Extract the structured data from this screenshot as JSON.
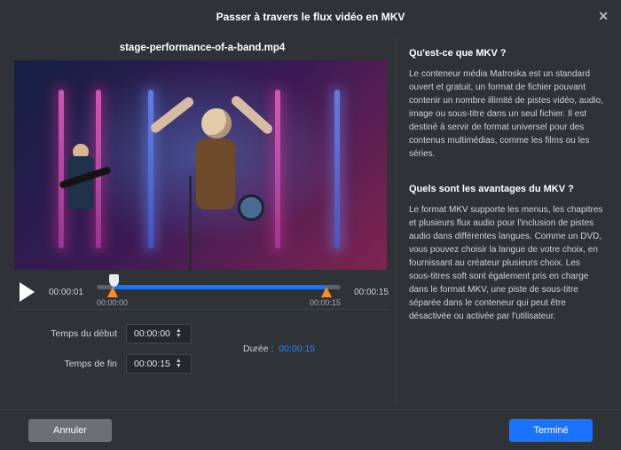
{
  "dialog": {
    "title": "Passer à travers le flux vidéo en MKV"
  },
  "file": {
    "name": "stage-performance-of-a-band.mp4"
  },
  "player": {
    "current_time": "00:00:01",
    "total_time": "00:00:15",
    "ruler_start": "00:00:00",
    "ruler_end": "00:00:15"
  },
  "trim": {
    "start_label": "Temps du début",
    "end_label": "Temps de fin",
    "start_value": "00:00:00",
    "end_value": "00:00:15",
    "duration_label": "Durée :",
    "duration_value": "00:00:15"
  },
  "info": {
    "q1_title": "Qu'est-ce que MKV ?",
    "q1_body": "Le conteneur média Matroska est un standard ouvert et gratuit, un format de fichier pouvant contenir un nombre illimité de pistes vidéo, audio, image ou sous-titre dans un seul fichier. Il est destiné à servir de format universel pour des contenus multimédias, comme les films ou les séries.",
    "q2_title": "Quels sont les avantages du MKV ?",
    "q2_body": "Le format MKV supporte les menus, les chapitres et plusieurs flux audio pour l'inclusion de pistes audio dans différentes langues. Comme un DVD, vous pouvez choisir la langue de votre choix, en fournissant au créateur plusieurs choix. Les sous-titres soft sont également pris en charge dans le format MKV, une piste de sous-titre séparée dans le conteneur qui peut être désactivée ou activée par l'utilisateur."
  },
  "buttons": {
    "cancel": "Annuler",
    "done": "Terminé"
  }
}
